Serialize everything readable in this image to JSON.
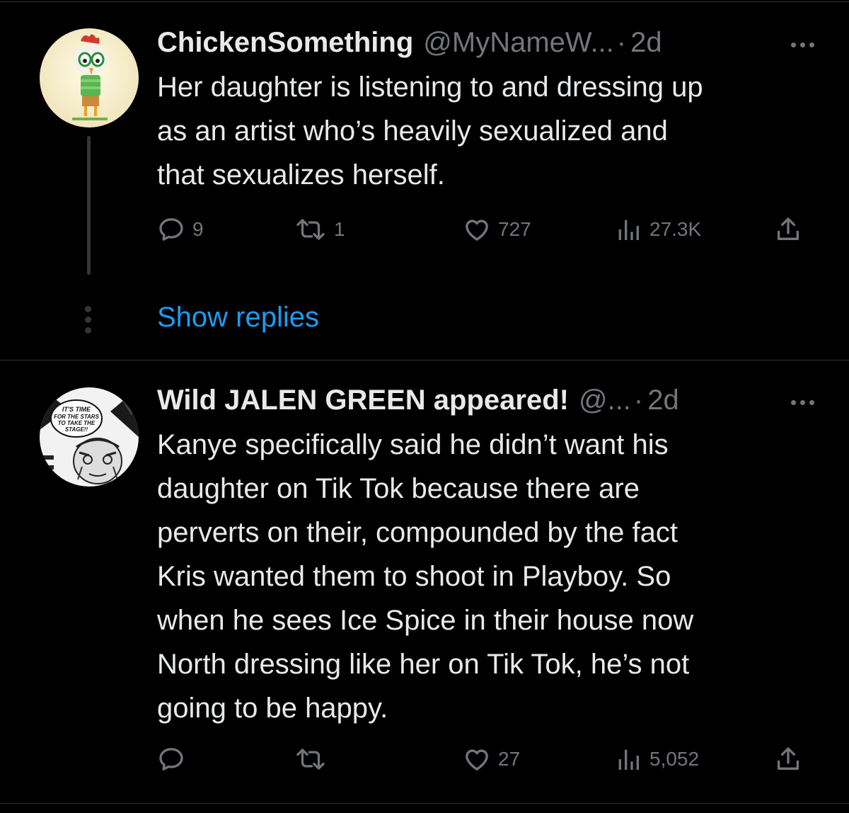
{
  "tweets": [
    {
      "name": "ChickenSomething",
      "handle": "@MyNameW...",
      "separator": "·",
      "time": "2d",
      "text": "Her daughter is listening to and dressing up\nas an artist who’s heavily sexualized and\nthat sexualizes herself.",
      "replies": "9",
      "retweets": "1",
      "likes": "727",
      "views": "27.3K",
      "avatar_icon": "cartoon-chicken-avatar"
    },
    {
      "name": "Wild JALEN GREEN appeared!",
      "handle": "@...",
      "separator": "·",
      "time": "2d",
      "text": "Kanye specifically said he didn’t want his\ndaughter on Tik Tok because there are\nperverts on their, compounded by the fact\nKris wanted them to shoot in Playboy. So\nwhen he sees Ice Spice in their house now\nNorth dressing like her on Tik Tok, he’s not\ngoing to be happy.",
      "replies": "",
      "retweets": "",
      "likes": "27",
      "views": "5,052",
      "avatar_icon": "manga-panel-avatar",
      "avatar_text": "IT'S TIME FOR THE STARS TO TAKE THE STAGE!!"
    }
  ],
  "show_replies_label": "Show replies",
  "colors": {
    "background": "#000000",
    "text": "#e7e9ea",
    "muted": "#71767b",
    "link": "#1d9bf0"
  }
}
